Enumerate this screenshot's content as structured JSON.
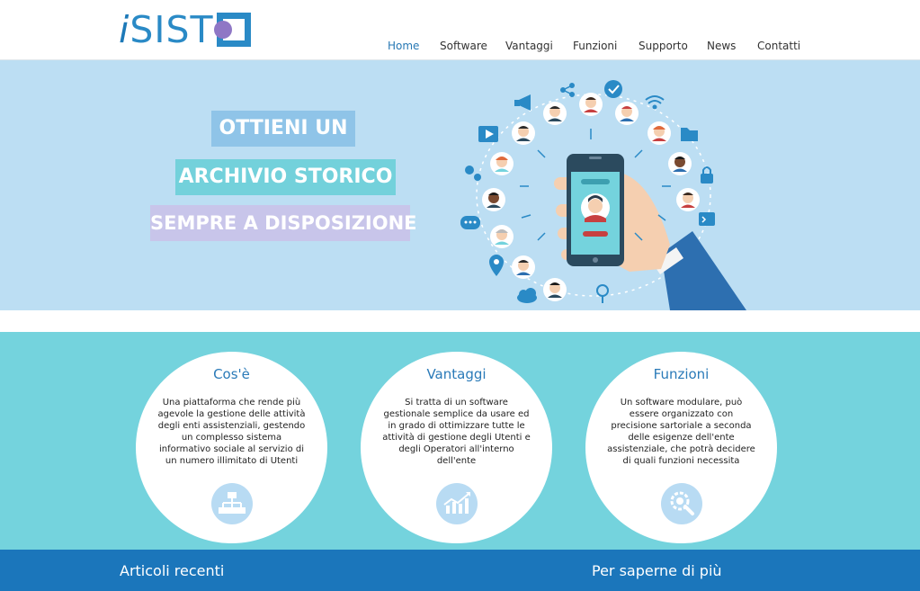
{
  "logo": {
    "text_i": "i",
    "text_rest": "SIST"
  },
  "nav": {
    "items": [
      {
        "label": "Home",
        "active": true
      },
      {
        "label": "Software",
        "active": false
      },
      {
        "label": "Vantaggi",
        "active": false
      },
      {
        "label": "Funzioni",
        "active": false
      },
      {
        "label": "Supporto",
        "active": false
      },
      {
        "label": "News",
        "active": false
      },
      {
        "label": "Contatti",
        "active": false
      }
    ]
  },
  "hero": {
    "line1": "OTTIENI UN",
    "line2": "ARCHIVIO STORICO",
    "line3": "SEMPRE A DISPOSIZIONE"
  },
  "features": [
    {
      "title": "Cos'è",
      "text": "Una piattaforma che rende più agevole la gestione delle attività degli enti assistenziali, gestendo un complesso sistema informativo sociale al servizio di un numero illimitato di Utenti",
      "icon": "sitemap-icon"
    },
    {
      "title": "Vantaggi",
      "text": "Si tratta di un software gestionale semplice da usare ed in grado di ottimizzare tutte le attività di gestione degli Utenti e degli Operatori all'interno dell'ente",
      "icon": "trend-chart-icon"
    },
    {
      "title": "Funzioni",
      "text": "Un software modulare, può essere organizzato con precisione sartoriale a seconda delle esigenze dell'ente assistenziale, che potrà decidere di quali funzioni necessita",
      "icon": "gear-search-icon"
    }
  ],
  "footer": {
    "left": "Articoli recenti",
    "right": "Per saperne di più"
  },
  "colors": {
    "brand": "#2a8ac6",
    "hero_bg": "#bcdef3",
    "features_bg": "#74d3dd",
    "footer_bg": "#1b76bb"
  }
}
